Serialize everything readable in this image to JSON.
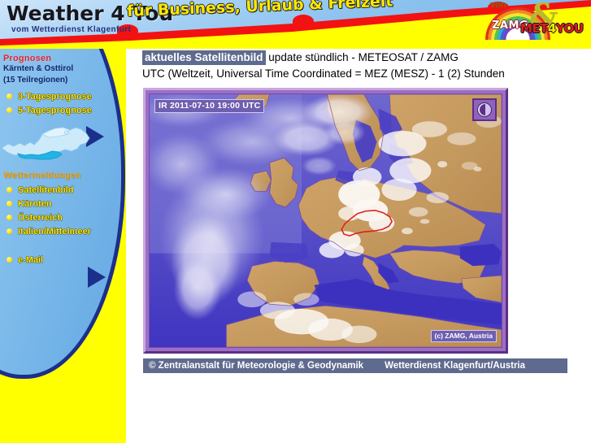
{
  "header": {
    "brand_title": "Weather 4 You",
    "brand_subtitle": "vom Wetterdienst Klagenfurt",
    "tagline": "für Business, Urlaub & Freizeit",
    "logo": {
      "von": "von",
      "zamg": "ZAMG",
      "amp": "&",
      "met": "MET",
      "four": "4",
      "you": "YOU"
    },
    "colors": {
      "yellow": "#ffff00",
      "red": "#f21212",
      "blue": "#8cc2ef",
      "navy": "#1c2f8c"
    }
  },
  "sidebar": {
    "forecast_heading": "Prognosen",
    "forecast_sub1": "Kärnten & Osttirol",
    "forecast_sub2": "(15 Teilregionen)",
    "forecast_links": [
      {
        "label": "3-Tagesprognose"
      },
      {
        "label": "5-Tagesprognose"
      }
    ],
    "map_alt": "Österreich Karte mit Kärnten hervorgehoben",
    "reports_heading": "Wettermeldungen",
    "report_links": [
      {
        "label": "Satellitenbild"
      },
      {
        "label": "Kärnten"
      },
      {
        "label": "Österreich"
      },
      {
        "label": "Italien/Mittelmeer"
      }
    ],
    "contact_links": [
      {
        "label": "e-Mail"
      }
    ]
  },
  "main": {
    "highlight": "aktuelles Satellitenbild",
    "line1_rest": " update stündlich - METEOSAT / ZAMG",
    "line2": "UTC (Weltzeit, Universal Time Coordinated = MEZ (MESZ) - 1 (2) Stunden",
    "satellite": {
      "timestamp": "IR 2011-07-10 19:00 UTC",
      "credit": "(c) ZAMG, Austria",
      "moon_icon": "moon-phase-icon"
    },
    "copyright": {
      "left": "© Zentralanstalt für Meteorologie & Geodynamik",
      "right": "Wetterdienst Klagenfurt/Austria"
    }
  }
}
